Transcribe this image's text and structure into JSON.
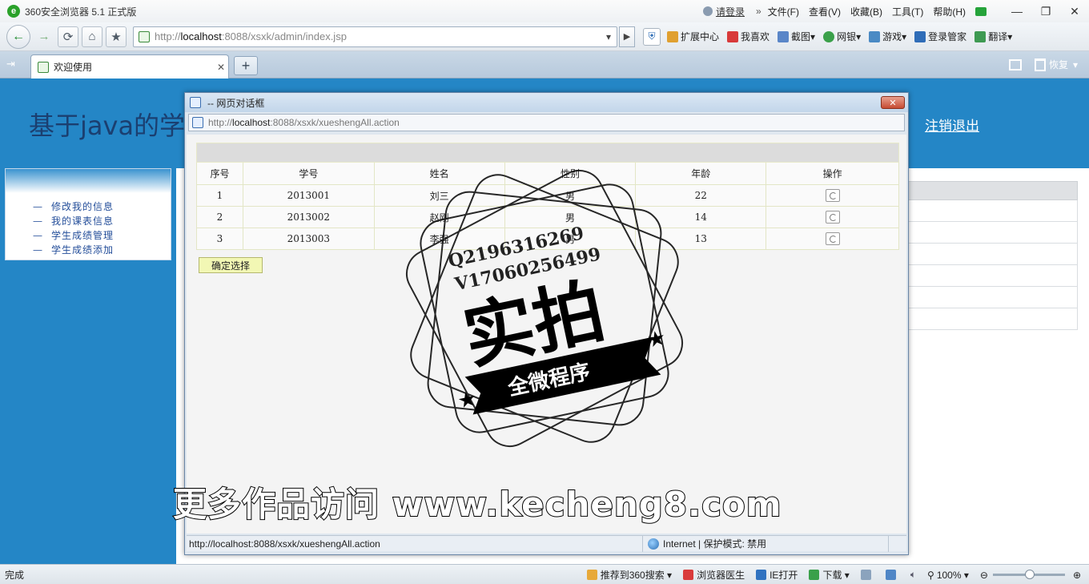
{
  "browser": {
    "title": "360安全浏览器 5.1 正式版",
    "login_label": "请登录",
    "menu": [
      "文件(F)",
      "查看(V)",
      "收藏(B)",
      "工具(T)",
      "帮助(H)"
    ],
    "address_prefix": "http://",
    "address_host": "localhost",
    "address_rest": ":8088/xsxk/admin/index.jsp",
    "toolbar_links": [
      "扩展中心",
      "我喜欢",
      "截图",
      "网银",
      "游戏",
      "登录管家",
      "翻译"
    ],
    "tab_label": "欢迎使用",
    "restore_label": "恢复",
    "status_text": "完成",
    "statusbar_items": [
      "推荐到360搜索",
      "浏览器医生",
      "IE打开",
      "下载"
    ],
    "zoom": "100%"
  },
  "page": {
    "header_title": "基于java的学",
    "logout_label": "注销退出",
    "left_menu": [
      "修改我的信息",
      "我的课表信息",
      "学生成绩管理",
      "学生成绩添加"
    ]
  },
  "dialog": {
    "title": "-- 网页对话框",
    "url_prefix": "http://",
    "url_host": "localhost",
    "url_rest": ":8088/xsxk/xueshengAll.action",
    "status_url": "http://localhost:8088/xsxk/xueshengAll.action",
    "status_zone": "Internet | 保护模式: 禁用",
    "table": {
      "headers": [
        "序号",
        "学号",
        "姓名",
        "性别",
        "年龄",
        "操作"
      ],
      "rows": [
        [
          "1",
          "2013001",
          "刘三",
          "男",
          "22"
        ],
        [
          "2",
          "2013002",
          "赵刚",
          "男",
          "14"
        ],
        [
          "3",
          "2013003",
          "李强",
          "男",
          "13"
        ]
      ]
    },
    "confirm_label": "确定选择"
  },
  "watermark": {
    "line1": "Q2196316269",
    "line2": "V17060256499",
    "big_text": "实拍",
    "ribbon_text": "全微程序",
    "banner": "更多作品访问 www.kecheng8.com"
  }
}
